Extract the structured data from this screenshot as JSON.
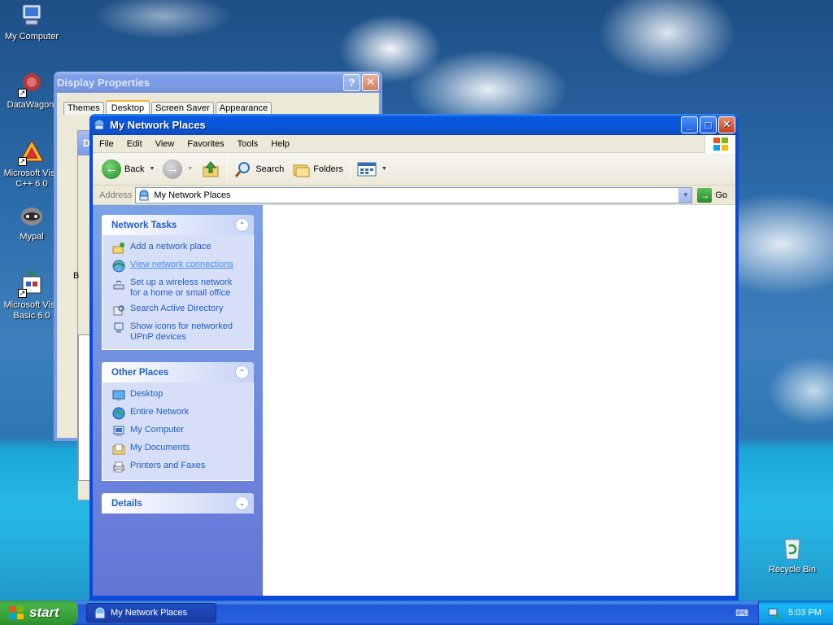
{
  "desktop": {
    "icons": [
      {
        "label": "My Computer"
      },
      {
        "label": "DataWagon."
      },
      {
        "label": "Microsoft Visu C++ 6.0"
      },
      {
        "label": "Mypal"
      },
      {
        "label": "Microsoft Visu Basic 6.0"
      },
      {
        "label": "Recycle Bin"
      }
    ]
  },
  "display_properties": {
    "title": "Display Properties",
    "tabs": [
      "Themes",
      "Desktop",
      "Screen Saver",
      "Appearance"
    ],
    "active_tab": "Desktop",
    "behind_title_initial": "D",
    "behind_label_initial": "B"
  },
  "window": {
    "title": "My Network Places",
    "menu": [
      "File",
      "Edit",
      "View",
      "Favorites",
      "Tools",
      "Help"
    ],
    "toolbar": {
      "back": "Back",
      "search": "Search",
      "folders": "Folders"
    },
    "address": {
      "label": "Address",
      "value": "My Network Places",
      "go": "Go"
    },
    "panels": {
      "network_tasks": {
        "title": "Network Tasks",
        "items": [
          {
            "label": "Add a network place"
          },
          {
            "label": "View network connections"
          },
          {
            "label": "Set up a wireless network for a home or small office"
          },
          {
            "label": "Search Active Directory"
          },
          {
            "label": "Show icons for networked UPnP devices"
          }
        ]
      },
      "other_places": {
        "title": "Other Places",
        "items": [
          {
            "label": "Desktop"
          },
          {
            "label": "Entire Network"
          },
          {
            "label": "My Computer"
          },
          {
            "label": "My Documents"
          },
          {
            "label": "Printers and Faxes"
          }
        ]
      },
      "details": {
        "title": "Details"
      }
    }
  },
  "taskbar": {
    "start": "start",
    "task_button": "My Network Places",
    "clock": "5:03 PM"
  },
  "colors": {
    "accent": "#0a4ad8",
    "link": "#215dc6",
    "start_green": "#37a037"
  }
}
